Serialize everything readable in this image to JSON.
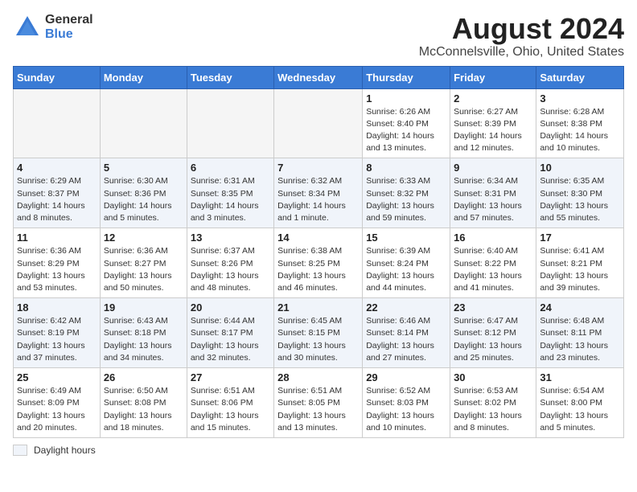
{
  "header": {
    "logo_general": "General",
    "logo_blue": "Blue",
    "title": "August 2024",
    "location": "McConnelsville, Ohio, United States"
  },
  "days_of_week": [
    "Sunday",
    "Monday",
    "Tuesday",
    "Wednesday",
    "Thursday",
    "Friday",
    "Saturday"
  ],
  "weeks": [
    [
      {
        "day": "",
        "info": ""
      },
      {
        "day": "",
        "info": ""
      },
      {
        "day": "",
        "info": ""
      },
      {
        "day": "",
        "info": ""
      },
      {
        "day": "1",
        "info": "Sunrise: 6:26 AM\nSunset: 8:40 PM\nDaylight: 14 hours\nand 13 minutes."
      },
      {
        "day": "2",
        "info": "Sunrise: 6:27 AM\nSunset: 8:39 PM\nDaylight: 14 hours\nand 12 minutes."
      },
      {
        "day": "3",
        "info": "Sunrise: 6:28 AM\nSunset: 8:38 PM\nDaylight: 14 hours\nand 10 minutes."
      }
    ],
    [
      {
        "day": "4",
        "info": "Sunrise: 6:29 AM\nSunset: 8:37 PM\nDaylight: 14 hours\nand 8 minutes."
      },
      {
        "day": "5",
        "info": "Sunrise: 6:30 AM\nSunset: 8:36 PM\nDaylight: 14 hours\nand 5 minutes."
      },
      {
        "day": "6",
        "info": "Sunrise: 6:31 AM\nSunset: 8:35 PM\nDaylight: 14 hours\nand 3 minutes."
      },
      {
        "day": "7",
        "info": "Sunrise: 6:32 AM\nSunset: 8:34 PM\nDaylight: 14 hours\nand 1 minute."
      },
      {
        "day": "8",
        "info": "Sunrise: 6:33 AM\nSunset: 8:32 PM\nDaylight: 13 hours\nand 59 minutes."
      },
      {
        "day": "9",
        "info": "Sunrise: 6:34 AM\nSunset: 8:31 PM\nDaylight: 13 hours\nand 57 minutes."
      },
      {
        "day": "10",
        "info": "Sunrise: 6:35 AM\nSunset: 8:30 PM\nDaylight: 13 hours\nand 55 minutes."
      }
    ],
    [
      {
        "day": "11",
        "info": "Sunrise: 6:36 AM\nSunset: 8:29 PM\nDaylight: 13 hours\nand 53 minutes."
      },
      {
        "day": "12",
        "info": "Sunrise: 6:36 AM\nSunset: 8:27 PM\nDaylight: 13 hours\nand 50 minutes."
      },
      {
        "day": "13",
        "info": "Sunrise: 6:37 AM\nSunset: 8:26 PM\nDaylight: 13 hours\nand 48 minutes."
      },
      {
        "day": "14",
        "info": "Sunrise: 6:38 AM\nSunset: 8:25 PM\nDaylight: 13 hours\nand 46 minutes."
      },
      {
        "day": "15",
        "info": "Sunrise: 6:39 AM\nSunset: 8:24 PM\nDaylight: 13 hours\nand 44 minutes."
      },
      {
        "day": "16",
        "info": "Sunrise: 6:40 AM\nSunset: 8:22 PM\nDaylight: 13 hours\nand 41 minutes."
      },
      {
        "day": "17",
        "info": "Sunrise: 6:41 AM\nSunset: 8:21 PM\nDaylight: 13 hours\nand 39 minutes."
      }
    ],
    [
      {
        "day": "18",
        "info": "Sunrise: 6:42 AM\nSunset: 8:19 PM\nDaylight: 13 hours\nand 37 minutes."
      },
      {
        "day": "19",
        "info": "Sunrise: 6:43 AM\nSunset: 8:18 PM\nDaylight: 13 hours\nand 34 minutes."
      },
      {
        "day": "20",
        "info": "Sunrise: 6:44 AM\nSunset: 8:17 PM\nDaylight: 13 hours\nand 32 minutes."
      },
      {
        "day": "21",
        "info": "Sunrise: 6:45 AM\nSunset: 8:15 PM\nDaylight: 13 hours\nand 30 minutes."
      },
      {
        "day": "22",
        "info": "Sunrise: 6:46 AM\nSunset: 8:14 PM\nDaylight: 13 hours\nand 27 minutes."
      },
      {
        "day": "23",
        "info": "Sunrise: 6:47 AM\nSunset: 8:12 PM\nDaylight: 13 hours\nand 25 minutes."
      },
      {
        "day": "24",
        "info": "Sunrise: 6:48 AM\nSunset: 8:11 PM\nDaylight: 13 hours\nand 23 minutes."
      }
    ],
    [
      {
        "day": "25",
        "info": "Sunrise: 6:49 AM\nSunset: 8:09 PM\nDaylight: 13 hours\nand 20 minutes."
      },
      {
        "day": "26",
        "info": "Sunrise: 6:50 AM\nSunset: 8:08 PM\nDaylight: 13 hours\nand 18 minutes."
      },
      {
        "day": "27",
        "info": "Sunrise: 6:51 AM\nSunset: 8:06 PM\nDaylight: 13 hours\nand 15 minutes."
      },
      {
        "day": "28",
        "info": "Sunrise: 6:51 AM\nSunset: 8:05 PM\nDaylight: 13 hours\nand 13 minutes."
      },
      {
        "day": "29",
        "info": "Sunrise: 6:52 AM\nSunset: 8:03 PM\nDaylight: 13 hours\nand 10 minutes."
      },
      {
        "day": "30",
        "info": "Sunrise: 6:53 AM\nSunset: 8:02 PM\nDaylight: 13 hours\nand 8 minutes."
      },
      {
        "day": "31",
        "info": "Sunrise: 6:54 AM\nSunset: 8:00 PM\nDaylight: 13 hours\nand 5 minutes."
      }
    ]
  ],
  "legend": {
    "box_label": "Daylight hours"
  }
}
